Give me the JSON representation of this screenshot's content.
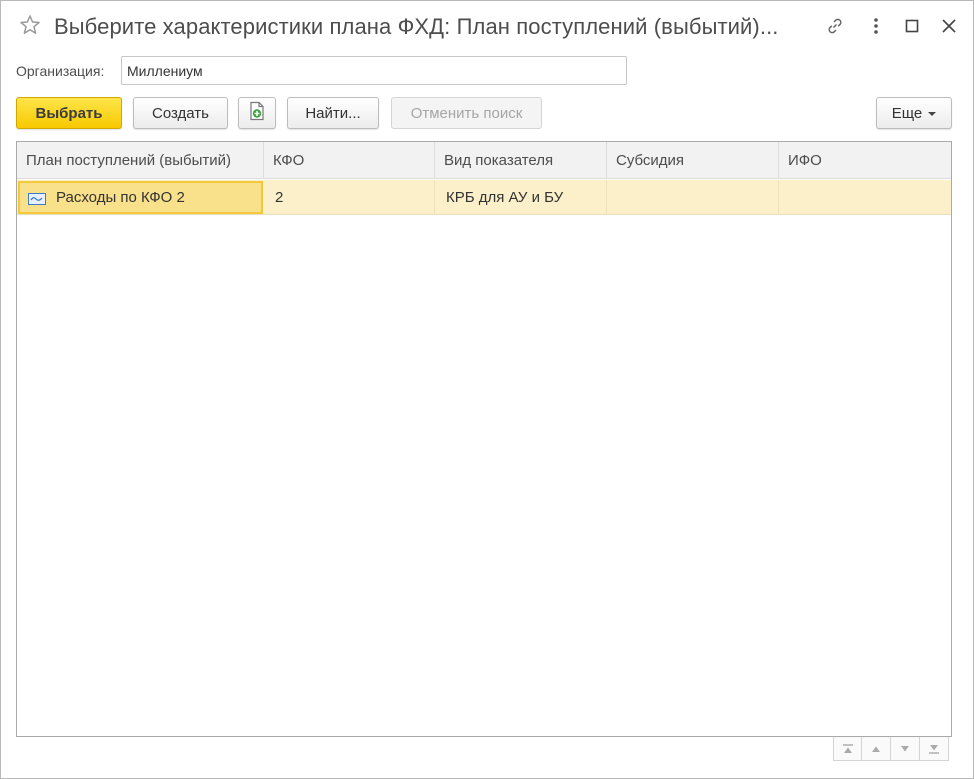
{
  "window": {
    "title": "Выберите характеристики плана ФХД: План поступлений (выбытий)..."
  },
  "icons": {
    "favorite": "star-icon",
    "link": "link-icon",
    "more": "more-vertical-icon",
    "maximize": "maximize-icon",
    "close": "close-icon",
    "copy": "copy-document-icon",
    "row": "catalog-item-icon"
  },
  "organization": {
    "label": "Организация:",
    "value": "Миллениум"
  },
  "toolbar": {
    "select_label": "Выбрать",
    "create_label": "Создать",
    "find_label": "Найти...",
    "cancel_search_label": "Отменить поиск",
    "more_label": "Еще"
  },
  "table": {
    "columns": [
      "План поступлений (выбытий)",
      "КФО",
      "Вид показателя",
      "Субсидия",
      "ИФО"
    ],
    "rows": [
      {
        "plan": "Расходы по КФО 2",
        "kfo": "2",
        "indicator_type": "КРБ для АУ и БУ",
        "subsidy": "",
        "ifo": ""
      }
    ]
  },
  "colors": {
    "accent": "#f7c900",
    "selected_row": "#fbf0c9",
    "selected_cell": "#f9e08a"
  }
}
